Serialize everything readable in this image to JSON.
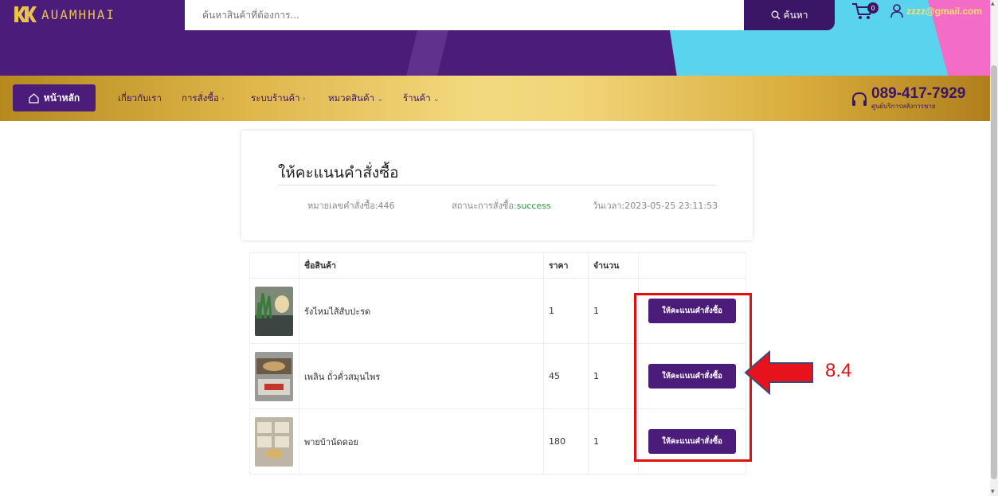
{
  "header": {
    "logo_text": "AUAMHHAI",
    "search_placeholder": "ค้นหาสินค้าที่ต้องการ...",
    "search_button": "ค้นหา",
    "cart_count": "0",
    "user_email": "zzzz@gmail.com"
  },
  "nav": {
    "home": "หน้าหลัก",
    "items": [
      {
        "label": "เกี่ยวกับเรา"
      },
      {
        "label": "การสั่งซื้อ"
      },
      {
        "label": "ระบบร้านค้า"
      },
      {
        "label": "หมวดสินค้า"
      },
      {
        "label": "ร้านค้า"
      }
    ],
    "hotline": "089-417-7929",
    "hotline_sub": "ศูนย์บริการหลังการขาย"
  },
  "order": {
    "title": "ให้คะแนนคำสั่งซื้อ",
    "number_label": "หมายเลขคำสั่งซื้อ:",
    "number": "446",
    "status_label": "สถานะการสั่งซื้อ:",
    "status": "success",
    "datetime_label": "วันเวลา:",
    "datetime": "2023-05-25 23:11:53"
  },
  "table": {
    "headers": [
      "",
      "ชื่อสินค้า",
      "ราคา",
      "จำนวน",
      ""
    ],
    "rows": [
      {
        "name": "รังไหมไส้สับปะรด",
        "price": "1",
        "qty": "1",
        "button": "ให้คะแนนคำสั่งซื้อ"
      },
      {
        "name": "เพลิน ถั่วคั่วสมุนไพร",
        "price": "45",
        "qty": "1",
        "button": "ให้คะแนนคำสั่งซื้อ"
      },
      {
        "name": "พายบ้านัดดอย",
        "price": "180",
        "qty": "1",
        "button": "ให้คะแนนคำสั่งซื้อ"
      }
    ]
  },
  "annotation": {
    "step_label": "8.4",
    "color": "#e01010"
  },
  "colors": {
    "brand_purple": "#4b1c7a",
    "gold": "#dfb64a",
    "cyan": "#5ad3ee",
    "pink": "#f36cc6"
  },
  "icons": [
    "logo-icon",
    "search-icon",
    "cart-icon",
    "user-icon",
    "home-icon",
    "chevron-right-icon",
    "chevron-down-icon",
    "headset-icon",
    "arrow-left-icon"
  ]
}
